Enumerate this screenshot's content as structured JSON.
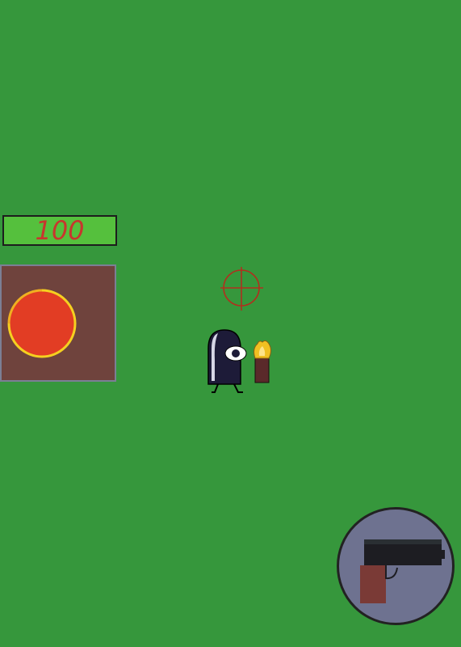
{
  "colors": {
    "field": "#36973c",
    "health_fill": "#55c03d",
    "health_text": "#c8362d",
    "ability_panel": "#6f433d",
    "ability_orb": "#e23d24",
    "ability_ring": "#f5d020",
    "crosshair": "#b0301e",
    "weapon_button_bg": "#6e7290",
    "pistol_slide": "#1d1d22",
    "pistol_grip": "#7a3a36"
  },
  "hud": {
    "health": {
      "value": "100",
      "fraction": 1.0
    },
    "ability": {
      "icon": "fire-orb-icon",
      "cooldown_fraction": 0.0
    },
    "weapon": {
      "icon": "pistol-icon"
    }
  },
  "world": {
    "crosshair_icon": "crosshair-icon",
    "player_icon": "one-eyed-ghost-icon",
    "held_item_icon": "torch-icon"
  }
}
